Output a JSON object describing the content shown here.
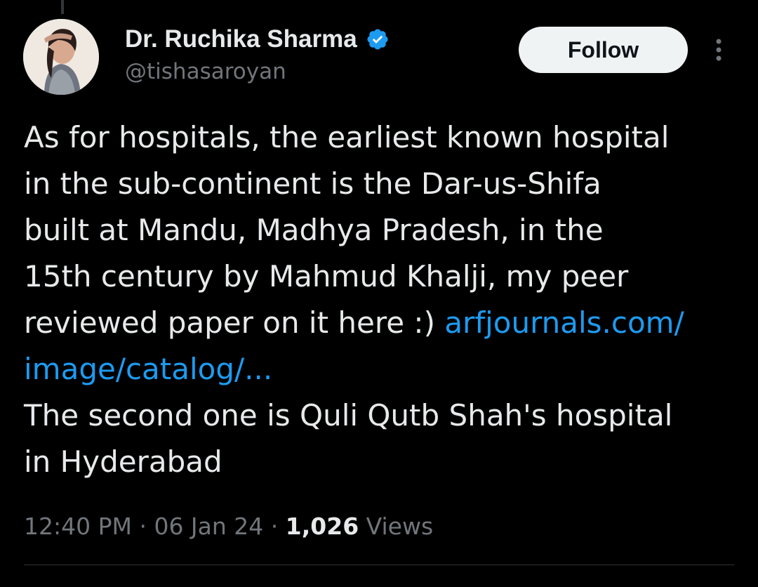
{
  "author": {
    "display_name": "Dr. Ruchika Sharma",
    "handle": "@tishasaroyan",
    "verified": true,
    "avatar_icon": "profile-photo"
  },
  "actions": {
    "follow_label": "Follow",
    "more_icon": "more-vertical-icon"
  },
  "tweet": {
    "lines": [
      "As for hospitals, the earliest known hospital",
      "in the sub-continent is the Dar-us-Shifa",
      "built at Mandu, Madhya Pradesh, in the",
      "15th century by Mahmud Khalji, my peer",
      "reviewed paper on it here :) "
    ],
    "link_part1": "arfjournals.com/",
    "link_part2": "image/catalog/...",
    "lines_after": [
      "The second one is Quli Qutb Shah's hospital",
      "in Hyderabad"
    ]
  },
  "meta": {
    "time": "12:40 PM",
    "sep1": " · ",
    "date": "06 Jan 24",
    "sep2": " · ",
    "views_count": "1,026",
    "views_label": " Views"
  },
  "colors": {
    "background": "#000000",
    "text_primary": "#e7e9ea",
    "text_secondary": "#71767b",
    "link": "#1d9bf0",
    "verified": "#1d9bf0",
    "follow_bg": "#eff3f4"
  }
}
